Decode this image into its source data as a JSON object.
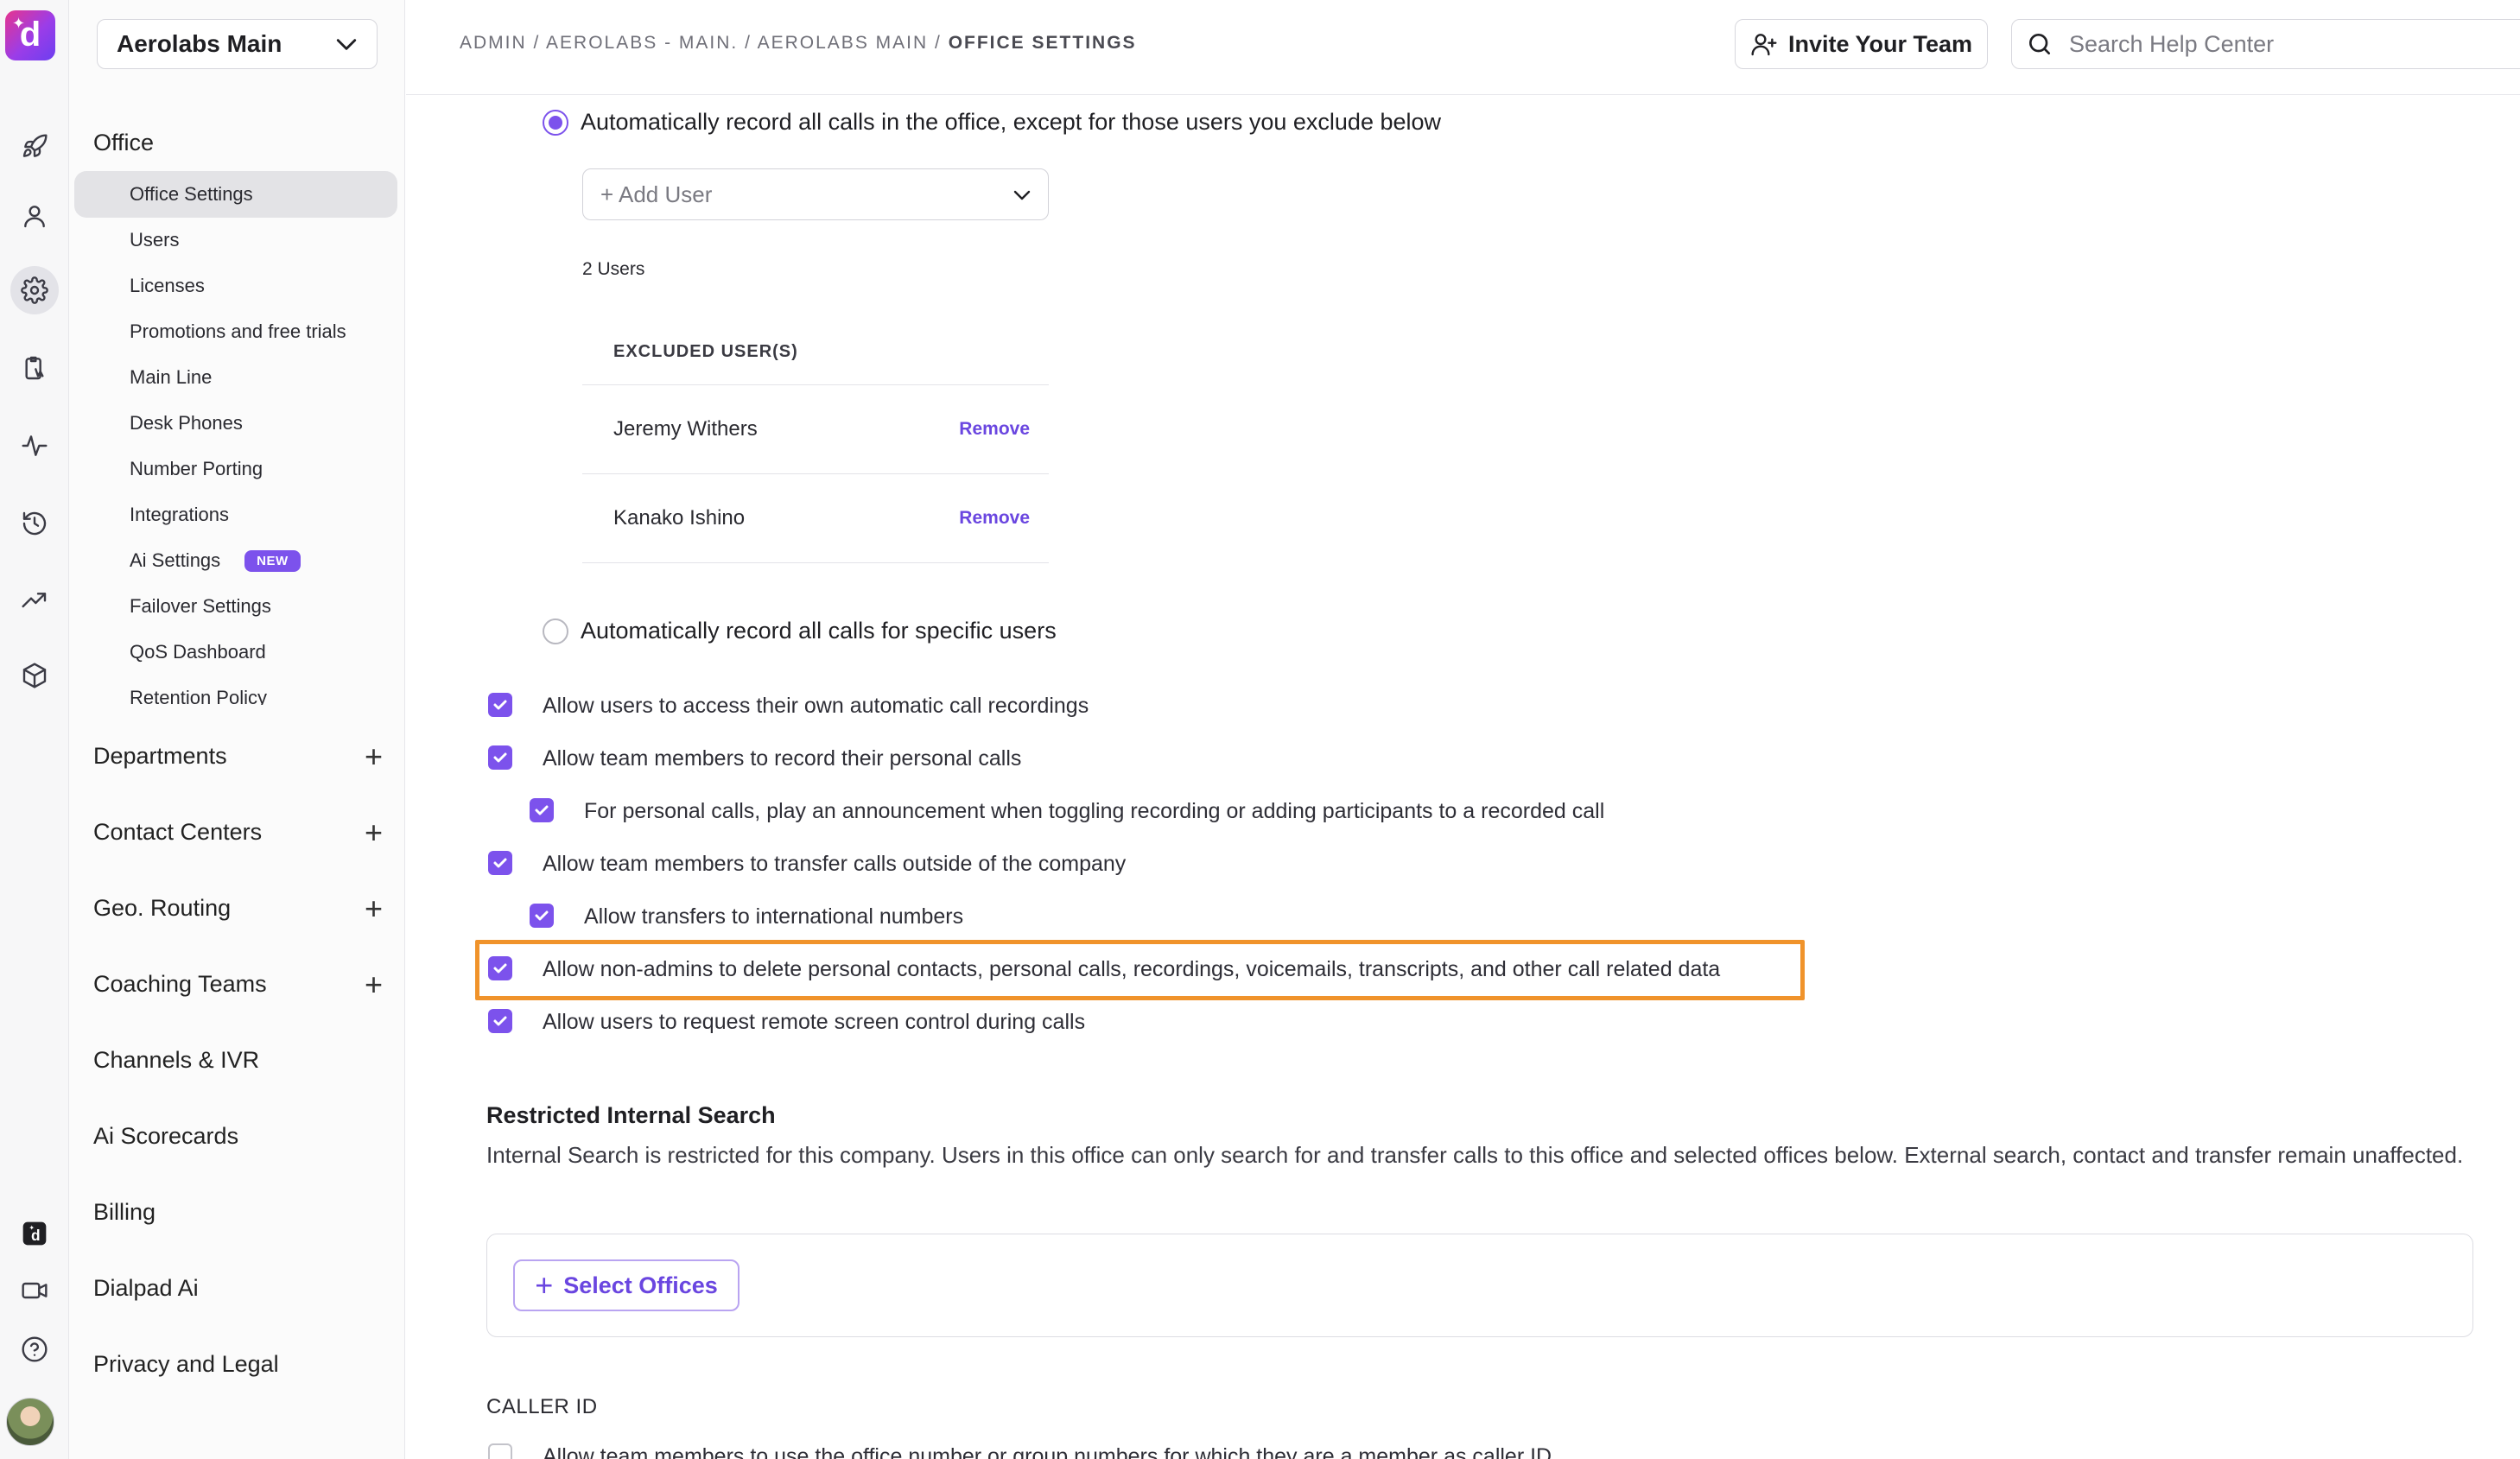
{
  "rail": {
    "logo_letter": "d",
    "icons": [
      "rocket-icon",
      "person-icon",
      "gear-icon",
      "clipboard-icon",
      "activity-icon",
      "history-icon",
      "trending-icon",
      "cube-icon",
      "dialpad-app-icon",
      "video-icon",
      "help-icon"
    ]
  },
  "sidebar": {
    "office_selector": "Aerolabs Main",
    "office_section": "Office",
    "office_items": [
      {
        "label": "Office Settings"
      },
      {
        "label": "Users"
      },
      {
        "label": "Licenses"
      },
      {
        "label": "Promotions and free trials"
      },
      {
        "label": "Main Line"
      },
      {
        "label": "Desk Phones"
      },
      {
        "label": "Number Porting"
      },
      {
        "label": "Integrations"
      },
      {
        "label": "Ai Settings",
        "badge": "NEW"
      },
      {
        "label": "Failover Settings"
      },
      {
        "label": "QoS Dashboard"
      },
      {
        "label": "Retention Policy"
      }
    ],
    "sections": [
      {
        "label": "Departments",
        "expandable": true
      },
      {
        "label": "Contact Centers",
        "expandable": true
      },
      {
        "label": "Geo. Routing",
        "expandable": true
      },
      {
        "label": "Coaching Teams",
        "expandable": true
      },
      {
        "label": "Channels & IVR",
        "expandable": false
      },
      {
        "label": "Ai Scorecards",
        "expandable": false
      },
      {
        "label": "Billing",
        "expandable": false
      },
      {
        "label": "Dialpad Ai",
        "expandable": false
      },
      {
        "label": "Privacy and Legal",
        "expandable": false
      }
    ]
  },
  "topbar": {
    "breadcrumb": [
      "ADMIN",
      "AEROLABS - MAIN.",
      "AEROLABS MAIN"
    ],
    "breadcrumb_sep": " / ",
    "breadcrumb_current": "OFFICE SETTINGS",
    "invite_label": "Invite Your Team",
    "search_placeholder": "Search Help Center"
  },
  "recording": {
    "option_all_except": "Automatically record all calls in the office, except for those users you exclude below",
    "add_user_placeholder": "+ Add User",
    "users_count": "2 Users",
    "excluded_header": "EXCLUDED USER(S)",
    "excluded_users": [
      {
        "name": "Jeremy Withers",
        "action": "Remove"
      },
      {
        "name": "Kanako Ishino",
        "action": "Remove"
      }
    ],
    "option_specific": "Automatically record all calls for specific users"
  },
  "permissions": [
    {
      "label": "Allow users to access their own automatic call recordings",
      "checked": true,
      "indent": 0
    },
    {
      "label": "Allow team members to record their personal calls",
      "checked": true,
      "indent": 0
    },
    {
      "label": "For personal calls, play an announcement when toggling recording or adding participants to a recorded call",
      "checked": true,
      "indent": 1
    },
    {
      "label": "Allow team members to transfer calls outside of the company",
      "checked": true,
      "indent": 0
    },
    {
      "label": "Allow transfers to international numbers",
      "checked": true,
      "indent": 1
    },
    {
      "label": "Allow non-admins to delete personal contacts, personal calls, recordings, voicemails, transcripts, and other call related data",
      "checked": true,
      "indent": 0,
      "highlighted": true
    },
    {
      "label": "Allow users to request remote screen control during calls",
      "checked": true,
      "indent": 0
    }
  ],
  "restricted_search": {
    "title": "Restricted Internal Search",
    "description": "Internal Search is restricted for this company. Users in this office can only search for and transfer calls to this office and selected offices below. External search, contact and transfer remain unaffected.",
    "select_label": "Select Offices"
  },
  "caller_id": {
    "heading": "CALLER ID",
    "first_option": "Allow team members to use the office number or group numbers for which they are a member as caller ID",
    "first_checked": false
  },
  "colors": {
    "accent": "#7c52ec",
    "highlight_border": "#f0932b"
  }
}
